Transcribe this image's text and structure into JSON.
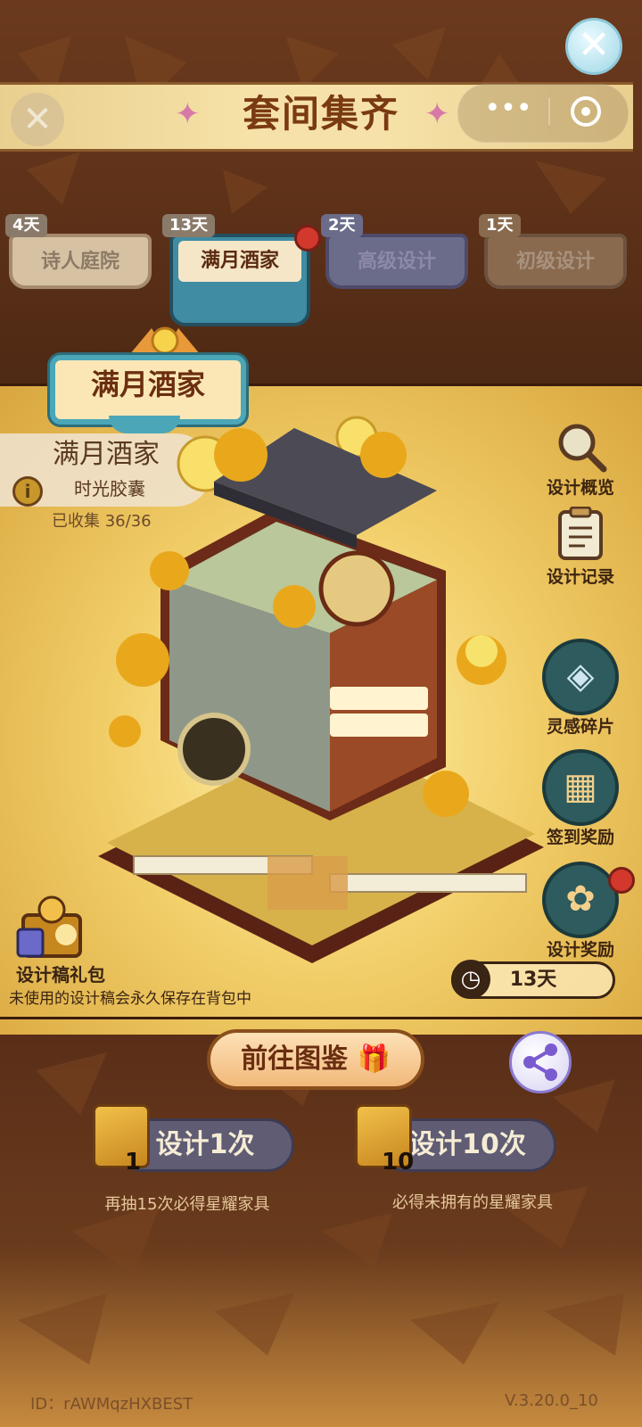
{
  "title": "套间集齐",
  "tabs": [
    {
      "days": "4天",
      "label": "诗人庭院"
    },
    {
      "days": "13天",
      "label": "满月酒家"
    },
    {
      "days": "2天",
      "label": "高级设计"
    },
    {
      "days": "1天",
      "label": "初级设计"
    }
  ],
  "banner": "满月酒家",
  "info": {
    "title": "满月酒家",
    "subtitle": "时光胶囊",
    "collected": "已收集 36/36"
  },
  "side_buttons": [
    {
      "label": "设计概览",
      "icon": "magnifier-icon"
    },
    {
      "label": "设计记录",
      "icon": "clipboard-icon"
    },
    {
      "label": "灵感碎片",
      "icon": "inspiration-shard-icon"
    },
    {
      "label": "签到奖励",
      "icon": "calendar-icon"
    },
    {
      "label": "设计奖励",
      "icon": "reward-icon"
    }
  ],
  "timer": "13天",
  "giftpack": {
    "label": "设计稿礼包",
    "note": "未使用的设计稿会永久保存在背包中"
  },
  "goto_button": "前往图鉴",
  "draw": [
    {
      "ticket_count": "1",
      "label": "设计1次",
      "note": "再抽15次必得星耀家具"
    },
    {
      "ticket_count": "10",
      "label": "设计10次",
      "note": "必得未拥有的星耀家具"
    }
  ],
  "footer": {
    "id": "ID：rAWMqzHXBEST",
    "version": "V.3.20.0_10"
  },
  "colors": {
    "accent": "#4ba6b8",
    "title": "#7a3a12",
    "badge": "#d3382c"
  }
}
